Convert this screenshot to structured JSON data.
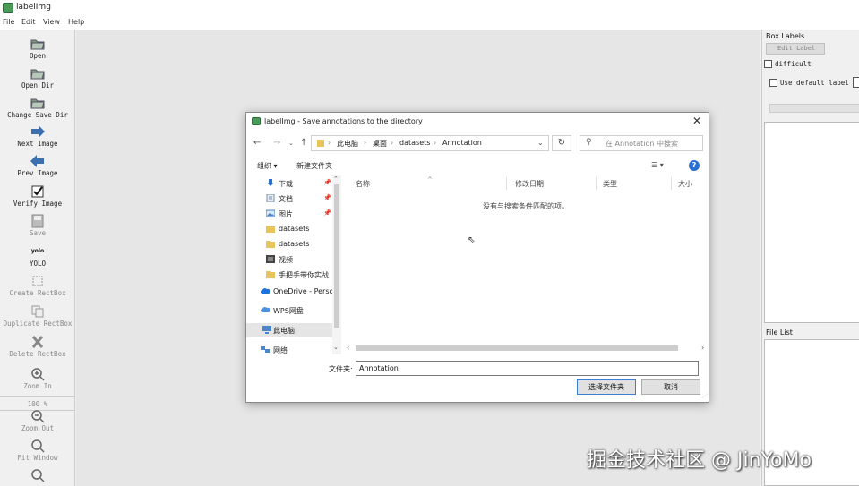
{
  "app": {
    "title": "labelImg"
  },
  "menu": [
    "File",
    "Edit",
    "View",
    "Help"
  ],
  "toolbar": [
    {
      "label": "Open",
      "icon": "folder-icon",
      "enabled": true
    },
    {
      "label": "Open Dir",
      "icon": "folder-open-icon",
      "enabled": true
    },
    {
      "label": "Change Save Dir",
      "icon": "folder-save-icon",
      "enabled": true
    },
    {
      "label": "Next Image",
      "icon": "arrow-right-icon",
      "enabled": true
    },
    {
      "label": "Prev Image",
      "icon": "arrow-left-icon",
      "enabled": true
    },
    {
      "label": "Verify Image",
      "icon": "checkbox-icon",
      "enabled": true
    },
    {
      "label": "Save",
      "icon": "save-icon",
      "enabled": false
    },
    {
      "label": "YOLO",
      "icon": "yolo-icon",
      "icon_text": "yolo",
      "enabled": true
    },
    {
      "label": "Create RectBox",
      "icon": "rectbox-icon",
      "enabled": false
    },
    {
      "label": "Duplicate RectBox",
      "icon": "duplicate-icon",
      "enabled": false
    },
    {
      "label": "Delete RectBox",
      "icon": "delete-icon",
      "enabled": false
    },
    {
      "label": "Zoom In",
      "icon": "zoom-in-icon",
      "enabled": false
    },
    {
      "label": "100 %",
      "icon": "",
      "enabled": false
    },
    {
      "label": "Zoom Out",
      "icon": "zoom-out-icon",
      "enabled": false
    },
    {
      "label": "Fit Window",
      "icon": "fit-window-icon",
      "enabled": false
    }
  ],
  "right_panel": {
    "box_labels_title": "Box Labels",
    "edit_label": "Edit Label",
    "difficult": "difficult",
    "use_default_label": "Use default label",
    "file_list_title": "File List"
  },
  "dialog": {
    "title": "labelImg - Save annotations to the directory",
    "breadcrumb": [
      "此电脑",
      "桌面",
      "datasets",
      "Annotation"
    ],
    "search_placeholder": "在 Annotation 中搜索",
    "organize": "组织 ▾",
    "new_folder": "新建文件夹",
    "help": "?",
    "nav_items": [
      {
        "label": "下载",
        "icon": "download-icon",
        "pinned": true,
        "color": "#2b6fd1"
      },
      {
        "label": "文档",
        "icon": "document-icon",
        "pinned": true,
        "color": "#7a8fa8"
      },
      {
        "label": "图片",
        "icon": "picture-icon",
        "pinned": true,
        "color": "#4a86c8"
      },
      {
        "label": "datasets",
        "icon": "folder-icon",
        "pinned": false,
        "color": "#e8c45a"
      },
      {
        "label": "datasets",
        "icon": "folder-icon",
        "pinned": false,
        "color": "#e8c45a"
      },
      {
        "label": "视频",
        "icon": "video-icon",
        "pinned": false,
        "color": "#555555"
      },
      {
        "label": "手把手带你实战",
        "icon": "folder-icon",
        "pinned": false,
        "color": "#e8c45a"
      },
      {
        "label": "OneDrive - Perso",
        "icon": "cloud-icon",
        "pinned": false,
        "color": "#1e73d8"
      },
      {
        "label": "WPS网盘",
        "icon": "cloud-icon",
        "pinned": false,
        "color": "#4d8fe0"
      },
      {
        "label": "此电脑",
        "icon": "computer-icon",
        "pinned": false,
        "color": "#4a86c8",
        "selected": true
      },
      {
        "label": "网络",
        "icon": "network-icon",
        "pinned": false,
        "color": "#4a86c8"
      }
    ],
    "columns": [
      "名称",
      "修改日期",
      "类型",
      "大小"
    ],
    "empty_message": "没有与搜索条件匹配的项。",
    "filename_label": "文件夹:",
    "filename_value": "Annotation",
    "select_folder": "选择文件夹",
    "cancel": "取消"
  },
  "watermark": "掘金技术社区 @ JinYoMo"
}
